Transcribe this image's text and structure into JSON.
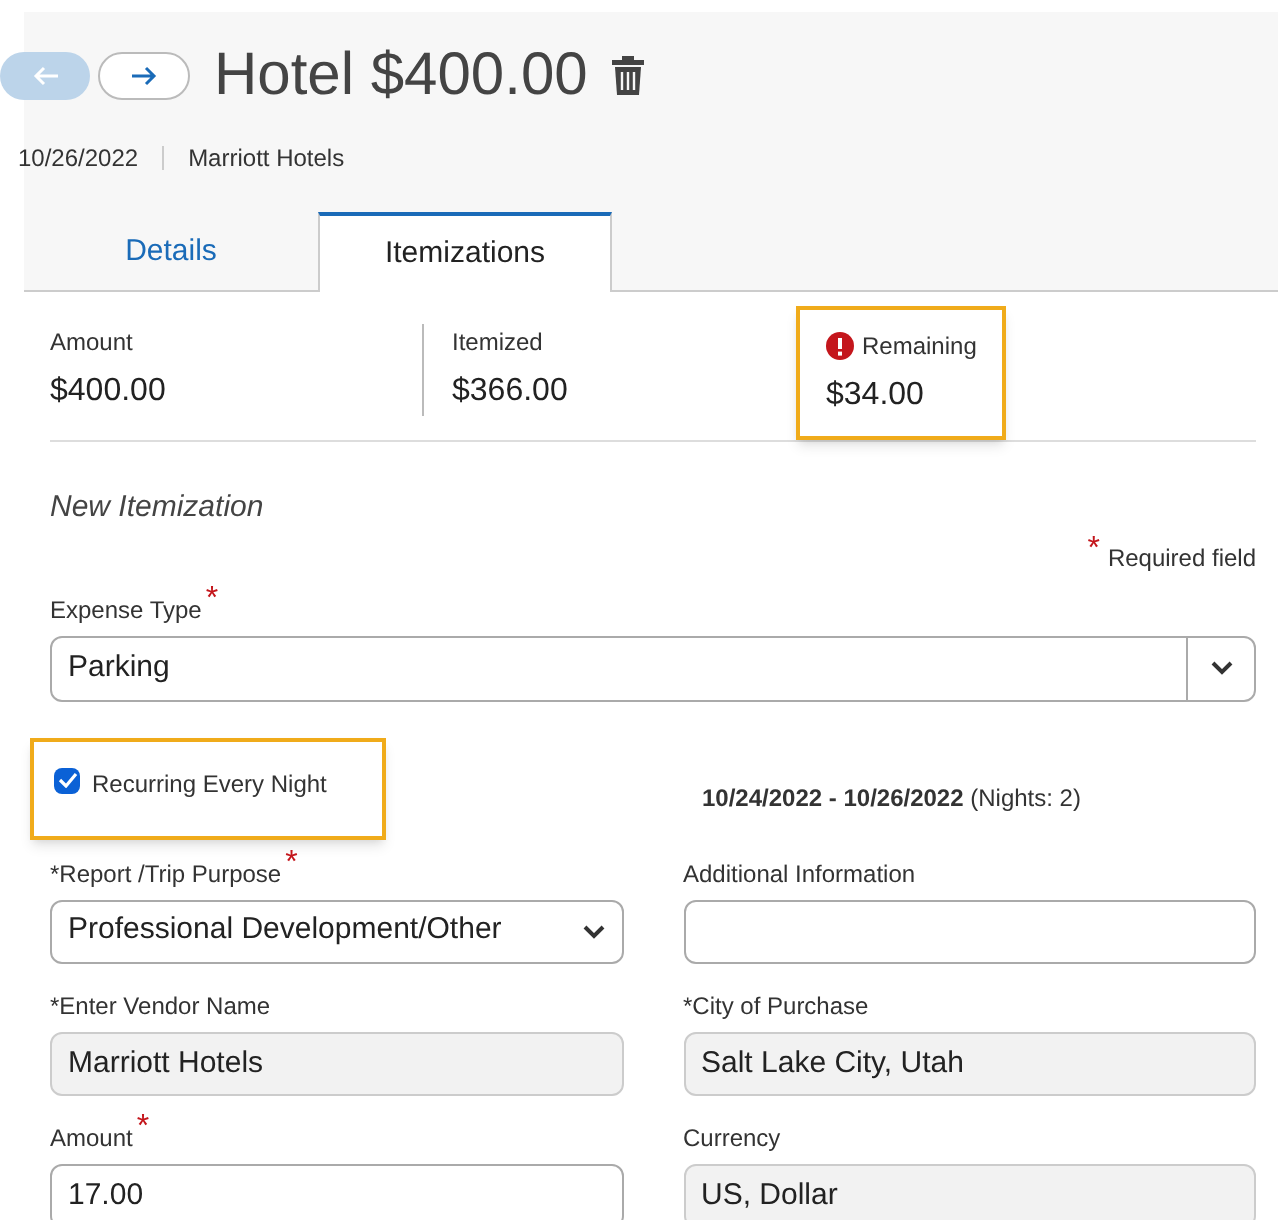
{
  "nav": {
    "back_disabled": true,
    "forward_disabled": false
  },
  "title": "Hotel $400.00",
  "meta": [
    "10/26/2022",
    "Marriott Hotels"
  ],
  "tabs": [
    {
      "label": "Details",
      "selected": false
    },
    {
      "label": "Itemizations",
      "selected": true
    }
  ],
  "summary": [
    {
      "label": "Amount",
      "value": "$400.00",
      "warning": false,
      "highlighted": false
    },
    {
      "label": "Itemized",
      "value": "$366.00",
      "warning": false,
      "highlighted": false
    },
    {
      "label": "Remaining",
      "value": "$34.00",
      "warning": true,
      "highlighted": true
    }
  ],
  "form": {
    "heading": "New Itemization",
    "required_mark": "*",
    "required_note": "Required field",
    "expense_type": {
      "label": "Expense Type",
      "required_mark": "*",
      "value": "Parking"
    },
    "recurring": {
      "label": "Recurring Every Night",
      "checked": true,
      "highlighted": true
    },
    "date_range": "**10/24/2022 - 10/26/2022** (Nights: 2)",
    "fields": [
      {
        "label": "*Report /Trip Purpose",
        "required_mark": "*",
        "kind": "select",
        "value": "Professional Development/Other"
      },
      {
        "label": "Additional Information",
        "kind": "text",
        "readonly": false
      },
      {
        "label": "*Enter Vendor Name",
        "kind": "text",
        "value": "Marriott Hotels",
        "readonly": true
      },
      {
        "label": "*City of Purchase",
        "kind": "text",
        "value": "Salt Lake City, Utah",
        "readonly": true
      },
      {
        "label": "Amount",
        "required_mark": "*",
        "kind": "text",
        "value": "17.00",
        "readonly": false
      },
      {
        "label": "Currency",
        "kind": "text",
        "value": "US, Dollar",
        "readonly": true
      }
    ]
  }
}
